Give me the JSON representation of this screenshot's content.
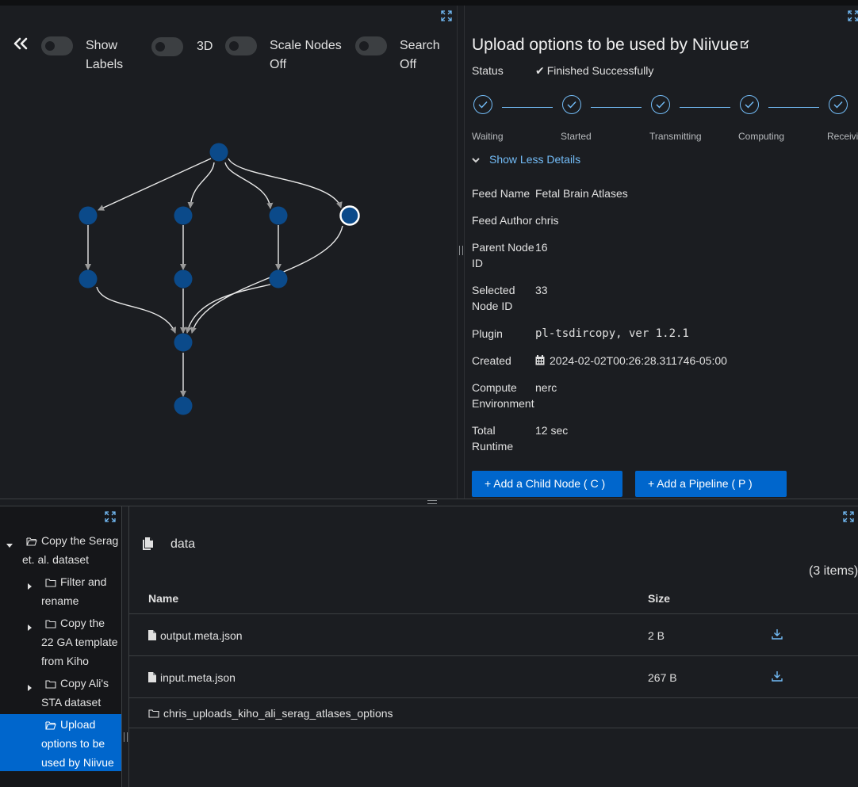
{
  "graph": {
    "toggles": [
      {
        "label": "Show Labels",
        "on": false
      },
      {
        "label": "3D",
        "on": false
      },
      {
        "label": "Scale Nodes Off",
        "on": false
      },
      {
        "label": "Search Off",
        "on": false
      }
    ],
    "node_count": 10,
    "selected_node": "33"
  },
  "details": {
    "title": "Upload options to be used by Niivue",
    "status_label": "Status",
    "status_value": "Finished Successfully",
    "steps": [
      "Waiting",
      "Started",
      "Transmitting",
      "Computing",
      "Receiving"
    ],
    "show_less": "Show Less Details",
    "fields": {
      "feed_name_label": "Feed Name",
      "feed_name": "Fetal Brain Atlases",
      "feed_author_label": "Feed Author",
      "feed_author": "chris",
      "parent_node_label_1": "Parent Node",
      "parent_node_label_2": "ID",
      "parent_node_id": "16",
      "selected_node_label_1": "Selected",
      "selected_node_label_2": "Node ID",
      "selected_node_id": "33",
      "plugin_label": "Plugin",
      "plugin": "pl-tsdircopy, ver 1.2.1",
      "created_label": "Created",
      "created": "2024-02-02T00:26:28.311746-05:00",
      "compute_label_1": "Compute",
      "compute_label_2": "Environment",
      "compute_env": "nerc",
      "runtime_label_1": "Total",
      "runtime_label_2": "Runtime",
      "runtime": "12 sec"
    },
    "buttons": {
      "add_child": "+  Add a Child Node ( C )",
      "add_pipeline": "+  Add a Pipeline ( P )"
    }
  },
  "tree": {
    "items": [
      {
        "lines": [
          "Copy the Serag",
          "et. al. dataset"
        ],
        "expanded": true,
        "selected": false
      },
      {
        "lines": [
          "Filter and",
          "rename"
        ],
        "expanded": false,
        "selected": false
      },
      {
        "lines": [
          "Copy the",
          "22 GA template",
          "from Kiho"
        ],
        "expanded": false,
        "selected": false
      },
      {
        "lines": [
          "Copy Ali's",
          "STA dataset"
        ],
        "expanded": false,
        "selected": false
      },
      {
        "lines": [
          "Upload",
          "options to be",
          "used by Niivue"
        ],
        "expanded": true,
        "selected": true
      }
    ]
  },
  "files": {
    "breadcrumb": "data",
    "item_count": "(3 items)",
    "columns": {
      "name": "Name",
      "size": "Size"
    },
    "rows": [
      {
        "name": "output.meta.json",
        "size": "2 B",
        "type": "file"
      },
      {
        "name": "input.meta.json",
        "size": "267 B",
        "type": "file"
      },
      {
        "name": "chris_uploads_kiho_ali_serag_atlases_options",
        "size": "",
        "type": "folder"
      }
    ]
  },
  "colors": {
    "accent": "#0066cc",
    "link": "#73bcf7",
    "node_fill": "#0b4a8a",
    "background": "#1b1d21"
  }
}
